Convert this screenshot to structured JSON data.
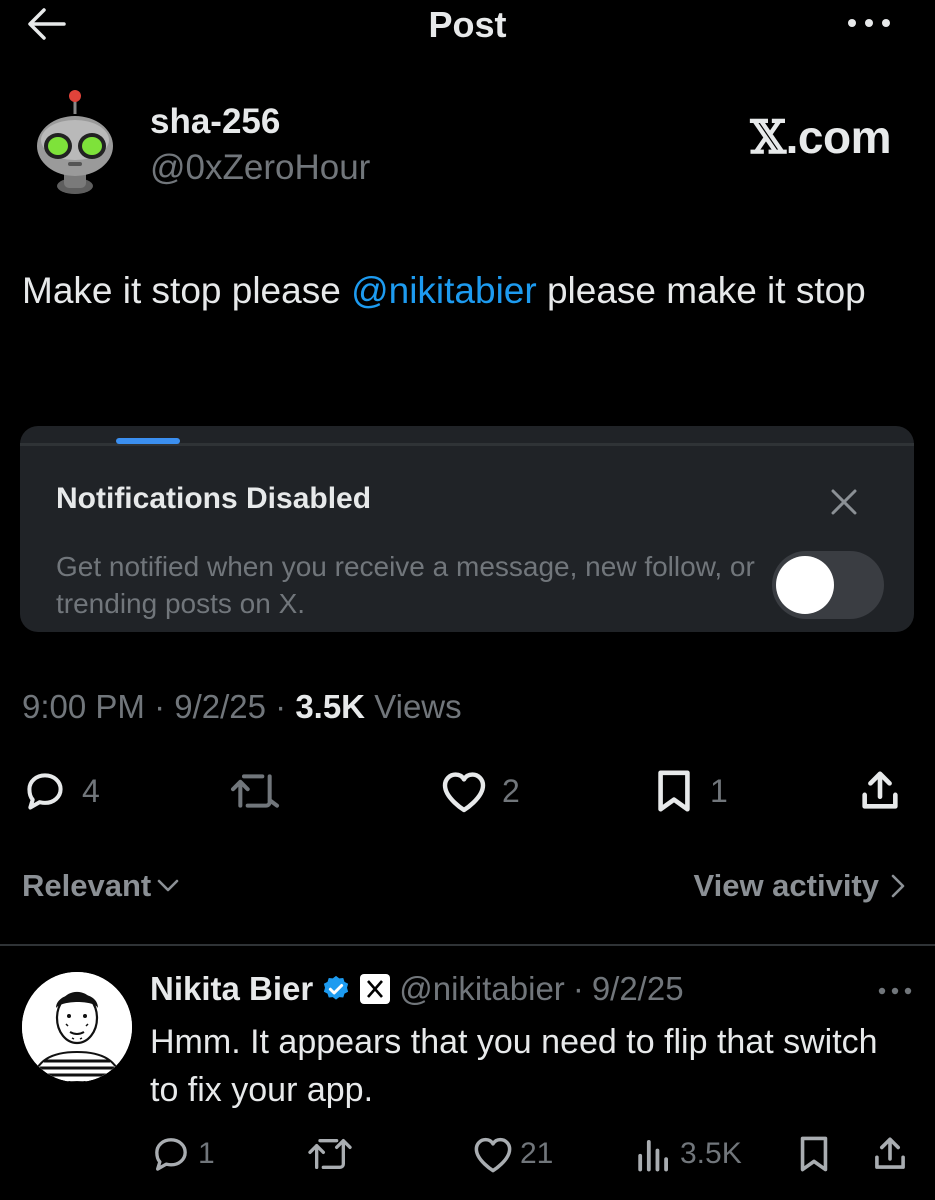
{
  "header": {
    "title": "Post"
  },
  "post": {
    "author_name": "sha-256",
    "author_handle": "@0xZeroHour",
    "watermark": ".com",
    "text_before": "Make it stop please ",
    "mention": "@nikitabier",
    "text_after": " please make it stop"
  },
  "notification_card": {
    "title": "Notifications Disabled",
    "body": "Get notified when you receive a message, new follow, or trending posts on X.",
    "toggle_on": false
  },
  "meta": {
    "time": "9:00 PM",
    "sep1": " · ",
    "date": "9/2/25",
    "sep2": " · ",
    "views_count": "3.5K",
    "views_label": " Views"
  },
  "actions": {
    "replies": "4",
    "likes": "2",
    "bookmarks": "1"
  },
  "filter": {
    "sort_label": "Relevant",
    "activity_label": "View activity"
  },
  "reply": {
    "name": "Nikita Bier",
    "handle": "@nikitabier",
    "dot": " · ",
    "date": "9/2/25",
    "text": "Hmm. It appears that you need to flip that switch to fix your app.",
    "replies": "1",
    "likes": "21",
    "views": "3.5K"
  },
  "colors": {
    "accent": "#1d9bf0",
    "background": "#000000",
    "muted": "#71767b",
    "card": "#202327"
  },
  "icons": [
    "back-arrow-icon",
    "more-icon",
    "robot-avatar",
    "close-icon",
    "reply-icon",
    "retweet-icon",
    "like-icon",
    "bookmark-icon",
    "share-icon",
    "chevron-down-icon",
    "chevron-right-icon",
    "verified-badge-icon",
    "x-logo-icon",
    "views-icon"
  ]
}
